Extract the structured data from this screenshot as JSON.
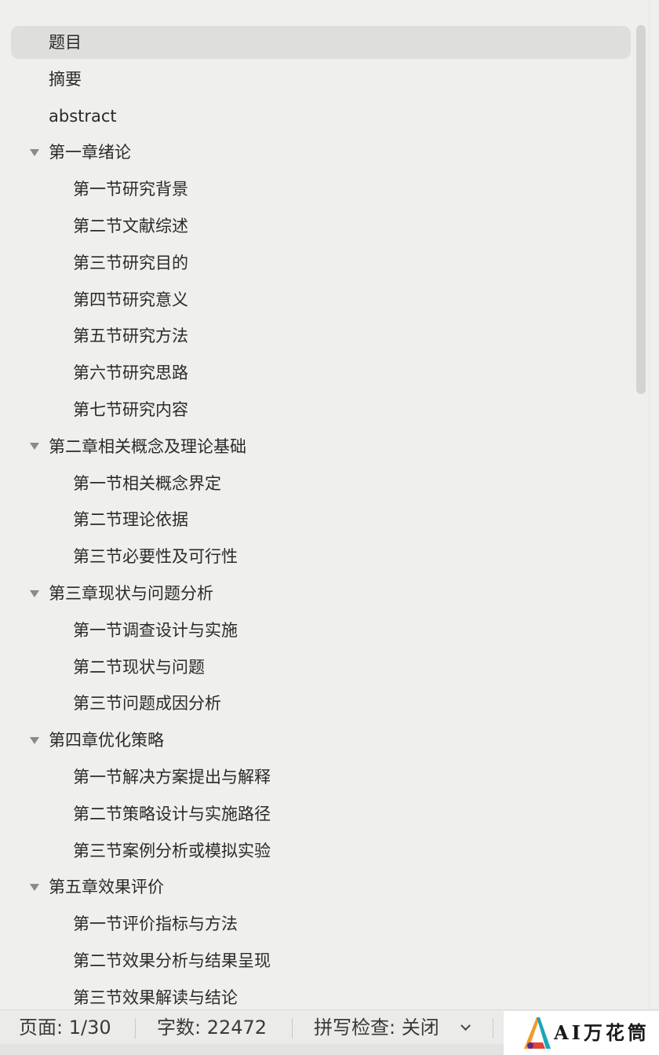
{
  "outline": {
    "items": [
      {
        "label": "题目",
        "level": 0,
        "expandable": false,
        "selected": true
      },
      {
        "label": "摘要",
        "level": 0,
        "expandable": false
      },
      {
        "label": "abstract",
        "level": 0,
        "expandable": false
      },
      {
        "label": "第一章绪论",
        "level": 0,
        "expandable": true,
        "expanded": true
      },
      {
        "label": "第一节研究背景",
        "level": 1
      },
      {
        "label": "第二节文献综述",
        "level": 1
      },
      {
        "label": "第三节研究目的",
        "level": 1
      },
      {
        "label": "第四节研究意义",
        "level": 1
      },
      {
        "label": "第五节研究方法",
        "level": 1
      },
      {
        "label": "第六节研究思路",
        "level": 1
      },
      {
        "label": "第七节研究内容",
        "level": 1
      },
      {
        "label": "第二章相关概念及理论基础",
        "level": 0,
        "expandable": true,
        "expanded": true
      },
      {
        "label": "第一节相关概念界定",
        "level": 1
      },
      {
        "label": "第二节理论依据",
        "level": 1
      },
      {
        "label": "第三节必要性及可行性",
        "level": 1
      },
      {
        "label": "第三章现状与问题分析",
        "level": 0,
        "expandable": true,
        "expanded": true
      },
      {
        "label": "第一节调查设计与实施",
        "level": 1
      },
      {
        "label": "第二节现状与问题",
        "level": 1
      },
      {
        "label": "第三节问题成因分析",
        "level": 1
      },
      {
        "label": "第四章优化策略",
        "level": 0,
        "expandable": true,
        "expanded": true
      },
      {
        "label": "第一节解决方案提出与解释",
        "level": 1
      },
      {
        "label": "第二节策略设计与实施路径",
        "level": 1
      },
      {
        "label": "第三节案例分析或模拟实验",
        "level": 1
      },
      {
        "label": "第五章效果评价",
        "level": 0,
        "expandable": true,
        "expanded": true
      },
      {
        "label": "第一节评价指标与方法",
        "level": 1
      },
      {
        "label": "第二节效果分析与结果呈现",
        "level": 1
      },
      {
        "label": "第三节效果解读与结论",
        "level": 1
      }
    ]
  },
  "status": {
    "page": "页面: 1/30",
    "words": "字数: 22472",
    "spellcheck": "拼写检查: 关闭"
  },
  "watermark": {
    "text": "AI万花筒"
  },
  "icons": {
    "expand_caret": "caret-down-icon",
    "spellcheck_dropdown": "chevron-down-icon",
    "watermark_logo": "ai-wanhuatong-logo"
  },
  "colors": {
    "background": "#efefed",
    "selection": "#dededc",
    "caret": "#8a8a8a",
    "scrollbar": "#d3d3d1"
  }
}
